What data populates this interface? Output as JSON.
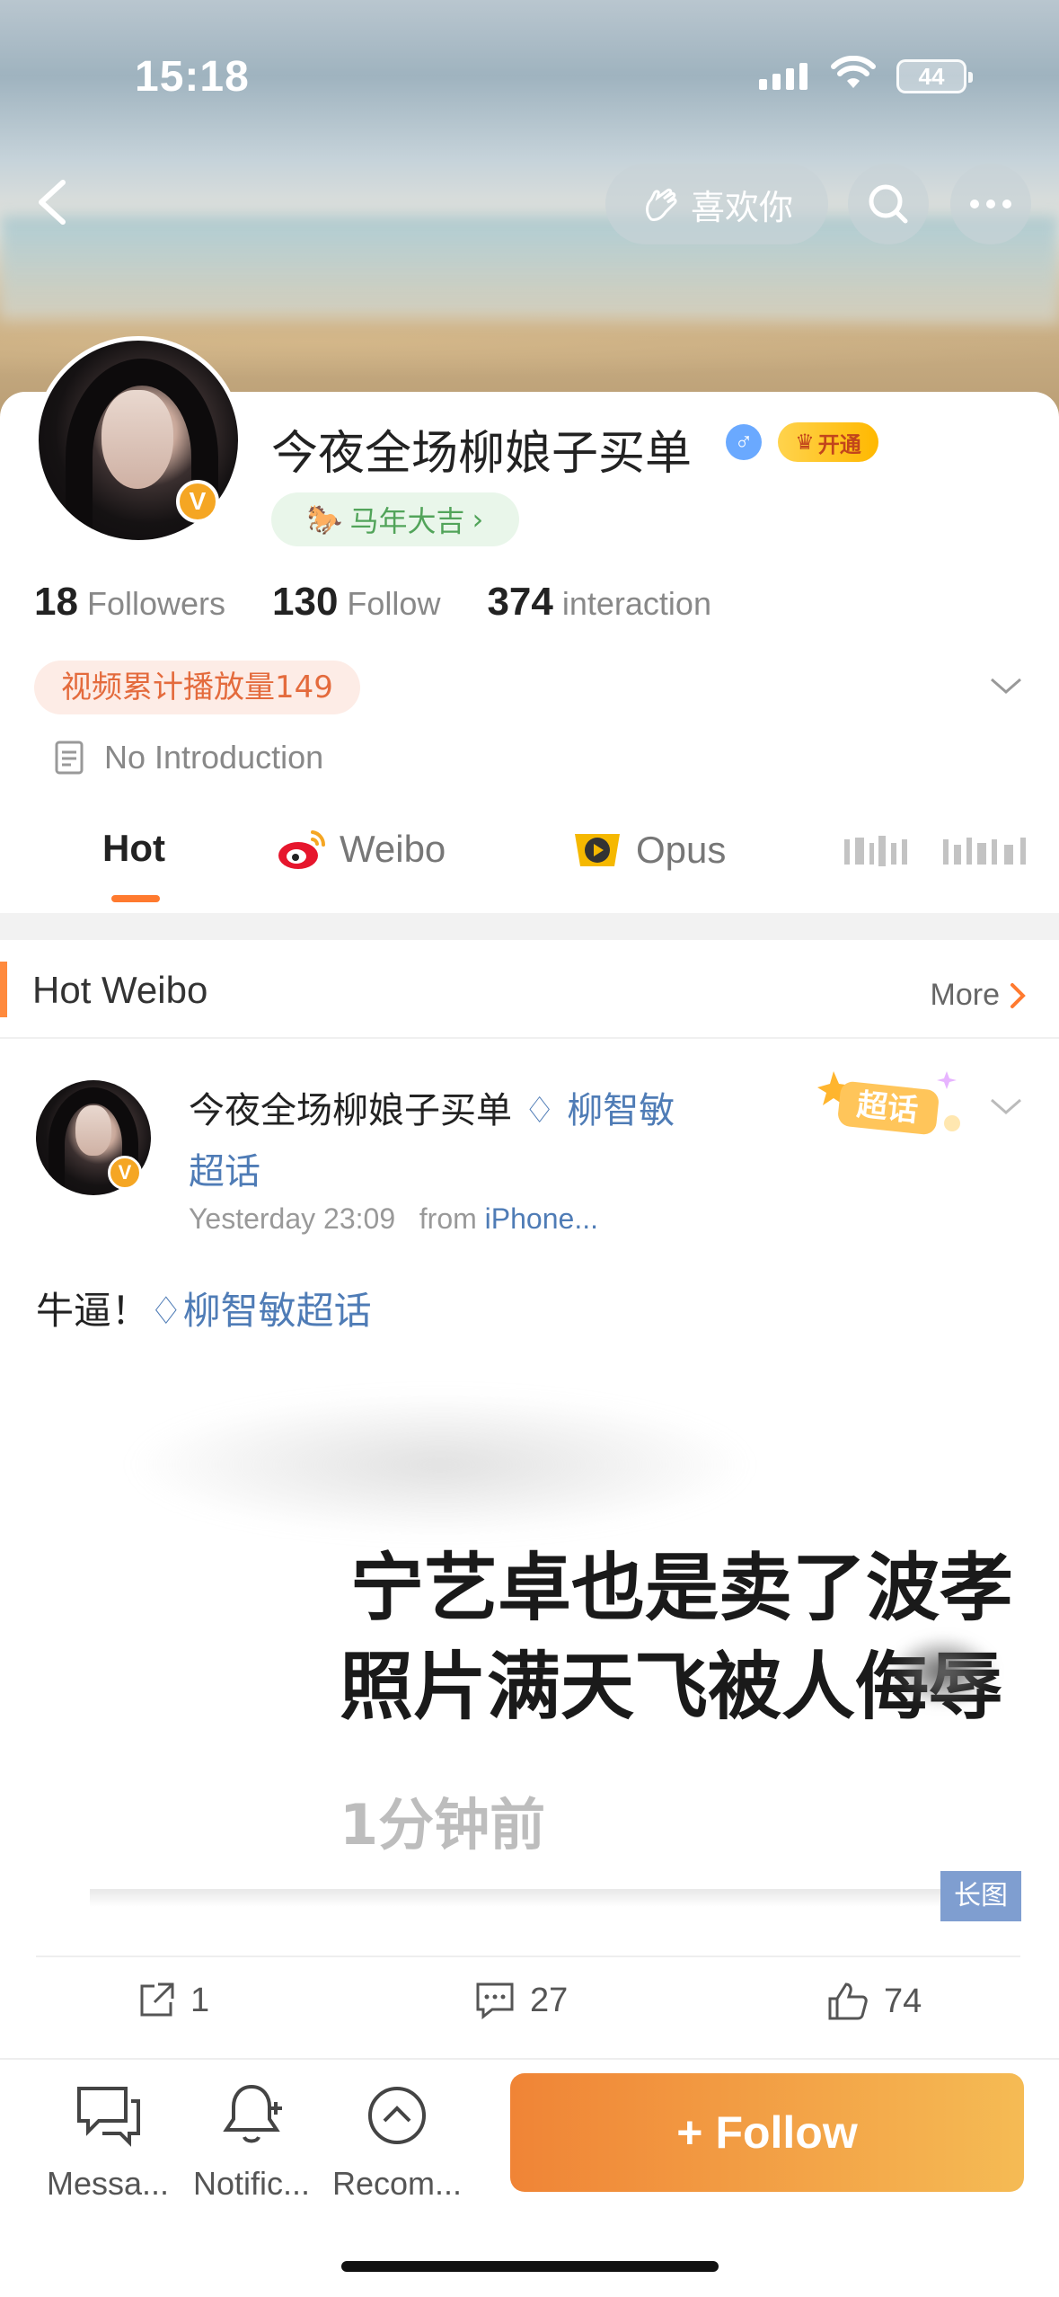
{
  "status": {
    "time": "15:18",
    "battery": "44"
  },
  "header": {
    "like_label": "喜欢你"
  },
  "profile": {
    "name": "今夜全场柳娘子买单",
    "vip_label": "开通",
    "tag": "马年大吉",
    "stats": [
      {
        "num": "18",
        "label": "Followers"
      },
      {
        "num": "130",
        "label": "Follow"
      },
      {
        "num": "374",
        "label": "interaction"
      }
    ],
    "play_count": "视频累计播放量149",
    "intro": "No Introduction"
  },
  "tabs": [
    {
      "label": "Hot"
    },
    {
      "label": "Weibo"
    },
    {
      "label": "Opus"
    }
  ],
  "section": {
    "title": "Hot Weibo",
    "more": "More"
  },
  "post": {
    "author": "今夜全场柳娘子买单",
    "topic_line1": "柳智敏",
    "topic_line2": "超话",
    "super_tag": "超话",
    "time": "Yesterday 23:09",
    "from_label": "from",
    "source": "iPhone...",
    "text": "牛逼！",
    "text_topic": "柳智敏超话",
    "image_lines": [
      "宁艺卓也是卖了波孝",
      "照片满天飞被人侮辱",
      "1分钟前"
    ],
    "long_image_label": "长图",
    "reposts": "1",
    "comments": "27",
    "likes": "74"
  },
  "bottom": {
    "messages": "Messa...",
    "notifications": "Notific...",
    "recommend": "Recom...",
    "follow": "Follow"
  },
  "colors": {
    "accent": "#ff7a2f",
    "link": "#4f7cb6",
    "follow_start": "#f08436",
    "follow_end": "#f5bb54"
  }
}
